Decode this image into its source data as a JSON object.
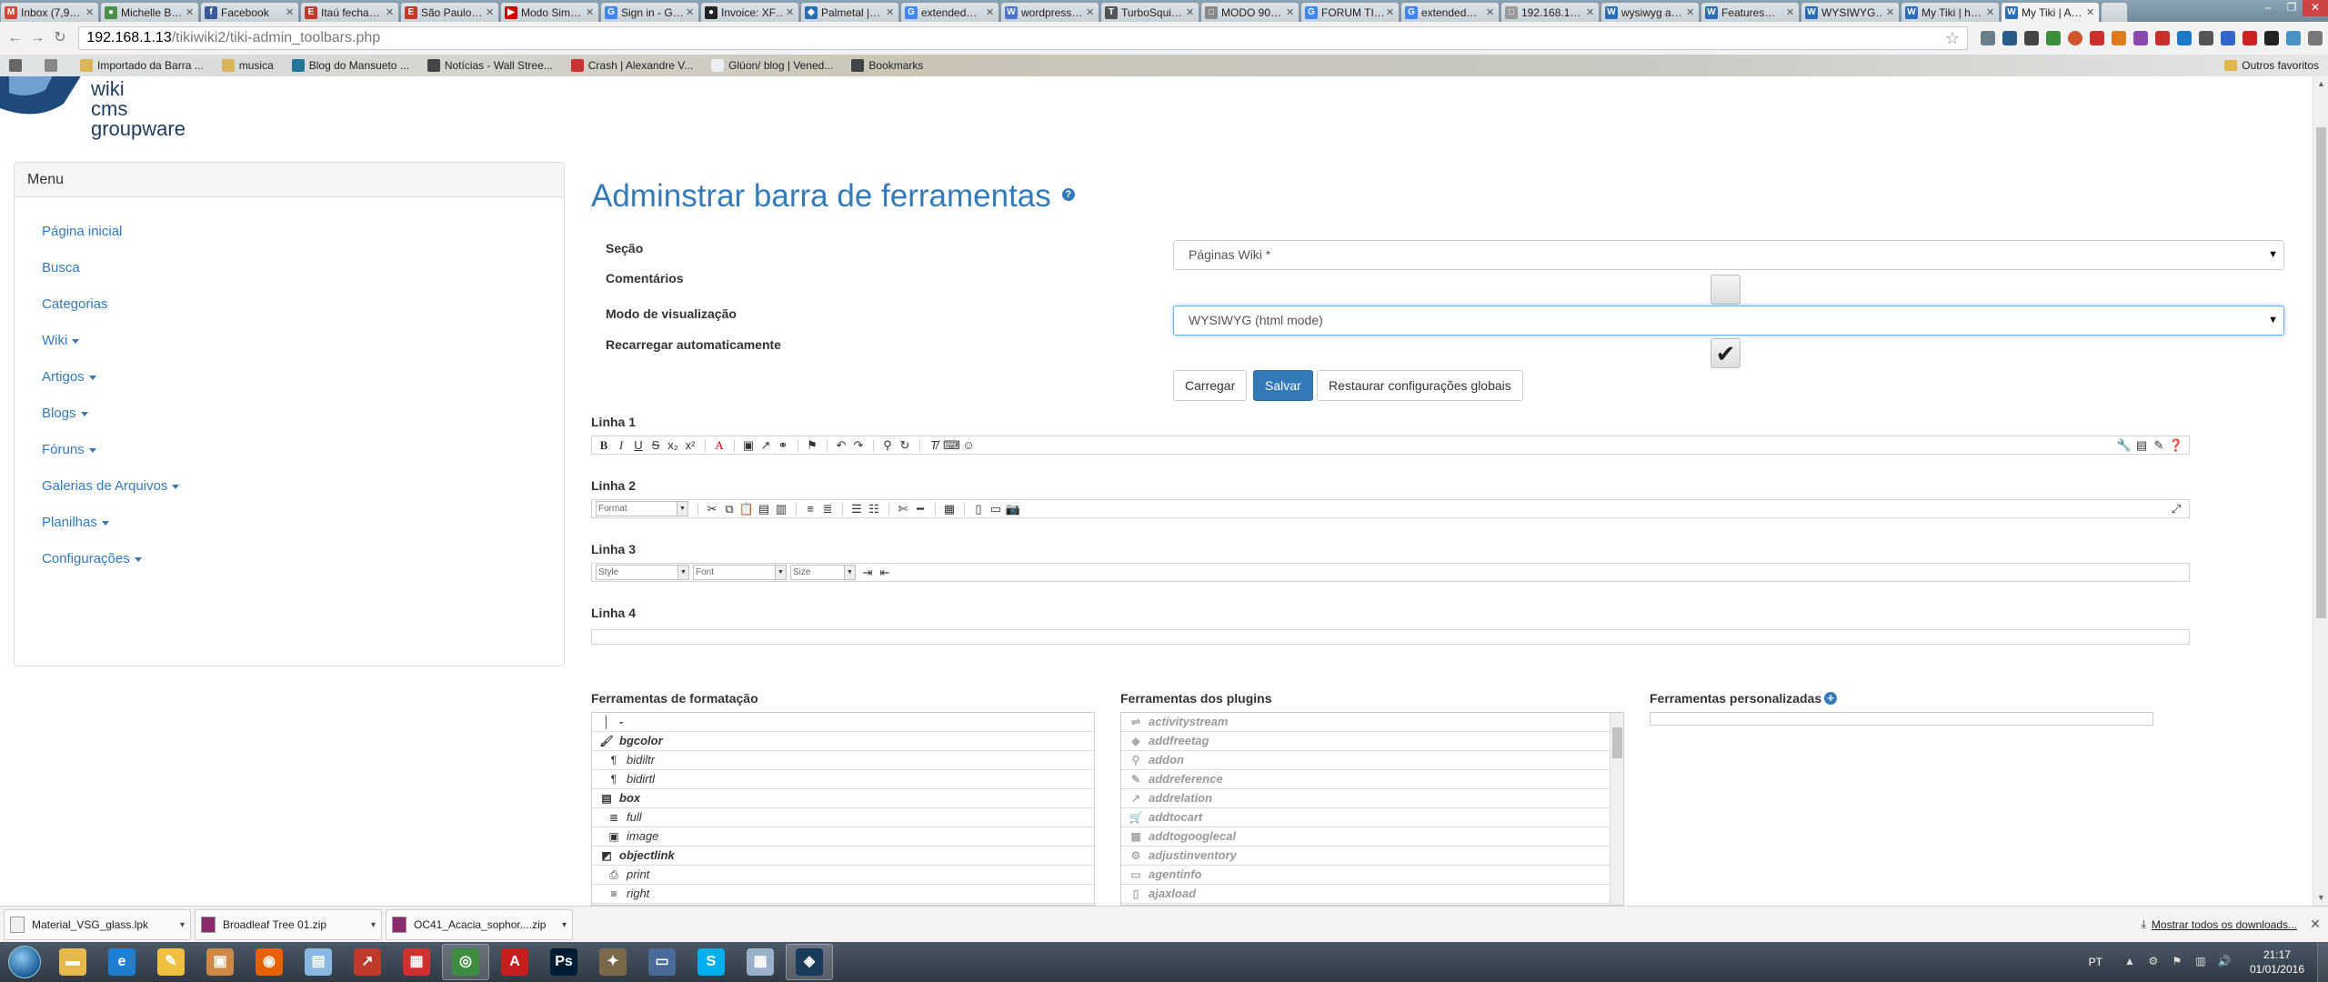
{
  "browser": {
    "tabs": [
      {
        "label": "Inbox (7,9…",
        "color": "#d14836",
        "glyph": "M"
      },
      {
        "label": "Michelle B…",
        "color": "#4a8f4a",
        "glyph": "●"
      },
      {
        "label": "Facebook",
        "color": "#3b5998",
        "glyph": "f"
      },
      {
        "label": "Itaú fecha…",
        "color": "#c0392b",
        "glyph": "E"
      },
      {
        "label": "São Paulo…",
        "color": "#c0392b",
        "glyph": "E"
      },
      {
        "label": "Modo Sim…",
        "color": "#cc0000",
        "glyph": "▶"
      },
      {
        "label": "Sign in - G…",
        "color": "#4285f4",
        "glyph": "G"
      },
      {
        "label": "Invoice: XF…",
        "color": "#222222",
        "glyph": "●"
      },
      {
        "label": "Palmetal |…",
        "color": "#2a6db5",
        "glyph": "◆"
      },
      {
        "label": "extended…",
        "color": "#4285f4",
        "glyph": "G"
      },
      {
        "label": "wordpress…",
        "color": "#4a76c9",
        "glyph": "W"
      },
      {
        "label": "TurboSqui…",
        "color": "#555555",
        "glyph": "T"
      },
      {
        "label": "MODO 90…",
        "color": "#888888",
        "glyph": "□"
      },
      {
        "label": "FORUM TI…",
        "color": "#4285f4",
        "glyph": "G"
      },
      {
        "label": "extended…",
        "color": "#4285f4",
        "glyph": "G"
      },
      {
        "label": "192.168.1…",
        "color": "#999999",
        "glyph": "□"
      },
      {
        "label": "wysiwyg a…",
        "color": "#2a6db5",
        "glyph": "W"
      },
      {
        "label": "Features…",
        "color": "#2a6db5",
        "glyph": "W"
      },
      {
        "label": "WYSIWYG…",
        "color": "#2a6db5",
        "glyph": "W"
      },
      {
        "label": "My Tiki | h…",
        "color": "#2a6db5",
        "glyph": "W"
      },
      {
        "label": "My Tiki | A…",
        "color": "#2a6db5",
        "glyph": "W",
        "active": true
      }
    ],
    "url_host": "192.168.1.13",
    "url_path": "/tikiwiki2/tiki-admin_toolbars.php",
    "bookmarks": [
      {
        "label": "",
        "color": "#666666"
      },
      {
        "label": "",
        "color": "#888888"
      },
      {
        "label": "Importado da Barra ...",
        "color": "#d9b45a"
      },
      {
        "label": "musica",
        "color": "#d9b45a"
      },
      {
        "label": "Blog do Mansueto ...",
        "color": "#21759b"
      },
      {
        "label": "Notícias - Wall Stree...",
        "color": "#444444"
      },
      {
        "label": "Crash | Alexandre V...",
        "color": "#cc3333"
      },
      {
        "label": "Glúon/ blog | Vened...",
        "color": "#eeeeee"
      },
      {
        "label": "Bookmarks",
        "color": "#444444"
      }
    ],
    "other_bookmarks": "Outros favoritos"
  },
  "logo": {
    "line1": "wiki",
    "line2": "cms",
    "line3": "groupware"
  },
  "menu": {
    "title": "Menu",
    "items": [
      {
        "label": "Página inicial",
        "dropdown": false
      },
      {
        "label": "Busca",
        "dropdown": false
      },
      {
        "label": "Categorias",
        "dropdown": false
      },
      {
        "label": "Wiki",
        "dropdown": true
      },
      {
        "label": "Artigos",
        "dropdown": true
      },
      {
        "label": "Blogs",
        "dropdown": true
      },
      {
        "label": "Fóruns",
        "dropdown": true
      },
      {
        "label": "Galerias de Arquivos",
        "dropdown": true
      },
      {
        "label": "Planilhas",
        "dropdown": true
      },
      {
        "label": "Configurações",
        "dropdown": true
      }
    ]
  },
  "form": {
    "title": "Adminstrar barra de ferramentas",
    "help_glyph": "?",
    "section_label": "Seção",
    "section_value": "Páginas Wiki *",
    "comments_label": "Comentários",
    "comments_checked": false,
    "view_mode_label": "Modo de visualização",
    "view_mode_value": "WYSIWYG (html mode)",
    "autoreload_label": "Recarregar automaticamente",
    "autoreload_checked": true,
    "load_button": "Carregar",
    "save_button": "Salvar",
    "restore_button": "Restaurar configurações globais"
  },
  "toolbars": {
    "line1_label": "Linha 1",
    "line2_label": "Linha 2",
    "line3_label": "Linha 3",
    "line4_label": "Linha 4",
    "line2_format": "Format",
    "line3_style": "Style",
    "line3_font": "Font",
    "line3_size": "Size"
  },
  "tools": {
    "formatting_heading": "Ferramentas de formatação",
    "plugins_heading": "Ferramentas dos plugins",
    "custom_heading": "Ferramentas personalizadas",
    "formatting": [
      {
        "label": "-",
        "icon": "│",
        "bold": true,
        "sub": false
      },
      {
        "label": "bgcolor",
        "icon": "🖌",
        "bold": true,
        "sub": false
      },
      {
        "label": "bidiltr",
        "icon": "¶",
        "bold": false,
        "sub": true
      },
      {
        "label": "bidirtl",
        "icon": "¶",
        "bold": false,
        "sub": true
      },
      {
        "label": "box",
        "icon": "▤",
        "bold": true,
        "sub": false
      },
      {
        "label": "full",
        "icon": "≣",
        "bold": false,
        "sub": true
      },
      {
        "label": "image",
        "icon": "▣",
        "bold": false,
        "sub": true
      },
      {
        "label": "objectlink",
        "icon": "◩",
        "bold": true,
        "sub": false
      },
      {
        "label": "print",
        "icon": "⎙",
        "bold": false,
        "sub": true
      },
      {
        "label": "right",
        "icon": "≡",
        "bold": false,
        "sub": true
      }
    ],
    "plugins": [
      {
        "label": "activitystream",
        "icon": "⇌"
      },
      {
        "label": "addfreetag",
        "icon": "◆"
      },
      {
        "label": "addon",
        "icon": "⚲"
      },
      {
        "label": "addreference",
        "icon": "✎"
      },
      {
        "label": "addrelation",
        "icon": "↗"
      },
      {
        "label": "addtocart",
        "icon": "🛒"
      },
      {
        "label": "addtogooglecal",
        "icon": "▦"
      },
      {
        "label": "adjustinventory",
        "icon": "⚙"
      },
      {
        "label": "agentinfo",
        "icon": "▭"
      },
      {
        "label": "ajaxload",
        "icon": "▯"
      }
    ]
  },
  "downloads": {
    "items": [
      {
        "label": "Material_VSG_glass.lpk",
        "color": "#f0f0f0"
      },
      {
        "label": "Broadleaf Tree 01.zip",
        "color": "#8a2b6e"
      },
      {
        "label": "OC41_Acacia_sophor....zip",
        "color": "#8a2b6e"
      }
    ],
    "show_all": "Mostrar todos os downloads..."
  },
  "taskbar": {
    "apps": [
      {
        "name": "explorer",
        "color": "#e7b84b",
        "glyph": "▬"
      },
      {
        "name": "ie",
        "color": "#1e7fd0",
        "glyph": "e"
      },
      {
        "name": "tool",
        "color": "#f0c040",
        "glyph": "✎"
      },
      {
        "name": "box",
        "color": "#cc8844",
        "glyph": "▣"
      },
      {
        "name": "firefox",
        "color": "#e66000",
        "glyph": "◉"
      },
      {
        "name": "notes",
        "color": "#88b8e0",
        "glyph": "▤"
      },
      {
        "name": "arrow",
        "color": "#c0392b",
        "glyph": "↗"
      },
      {
        "name": "grid",
        "color": "#d03030",
        "glyph": "▦"
      },
      {
        "name": "chrome",
        "color": "#3d8c40",
        "glyph": "◎",
        "active": true
      },
      {
        "name": "acrobat",
        "color": "#c41e1e",
        "glyph": "A"
      },
      {
        "name": "photoshop",
        "color": "#001d34",
        "glyph": "Ps"
      },
      {
        "name": "gimp",
        "color": "#7a6a4a",
        "glyph": "✦"
      },
      {
        "name": "display",
        "color": "#4a6a9a",
        "glyph": "▭"
      },
      {
        "name": "skype",
        "color": "#00aff0",
        "glyph": "S"
      },
      {
        "name": "calc",
        "color": "#9ab0c8",
        "glyph": "▦"
      },
      {
        "name": "netbeans",
        "color": "#1a3a5a",
        "glyph": "◈",
        "active": true
      }
    ],
    "lang": "PT",
    "time": "21:17",
    "date": "01/01/2016"
  }
}
